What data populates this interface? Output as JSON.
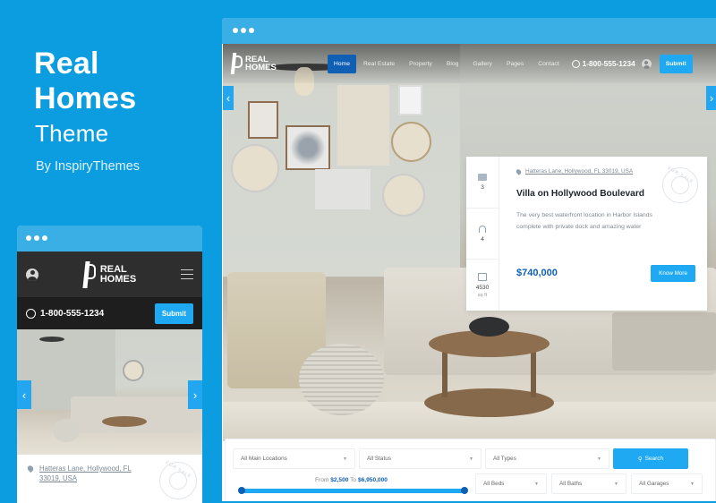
{
  "promo": {
    "title_line1": "Real",
    "title_line2": "Homes",
    "subtitle": "Theme",
    "byline": "By InspiryThemes"
  },
  "brand": {
    "accent": "#1ea9f2",
    "primary": "#0f5fb4",
    "background": "#0c9ce0",
    "logo_line1": "REAL",
    "logo_line2": "HOMES"
  },
  "desktop": {
    "nav": {
      "items": [
        {
          "label": "Home",
          "active": true
        },
        {
          "label": "Real Estate"
        },
        {
          "label": "Property"
        },
        {
          "label": "Blog"
        },
        {
          "label": "Gallery"
        },
        {
          "label": "Pages"
        },
        {
          "label": "Contact"
        }
      ],
      "phone": "1-800-555-1234",
      "submit_label": "Submit"
    },
    "slider": {
      "prev_icon": "‹",
      "next_icon": "›"
    },
    "property_card": {
      "features": [
        {
          "icon": "bed-icon",
          "value": "3"
        },
        {
          "icon": "shower-icon",
          "value": "4"
        },
        {
          "icon": "area-icon",
          "value": "4530",
          "unit": "sq ft"
        }
      ],
      "address": "Hatteras Lane, Hollywood, FL 33019, USA",
      "title": "Villa on Hollywood Boulevard",
      "description": "The very best waterfront location in Harbor Islands complete with private dock and amazing water",
      "price": "$740,000",
      "cta_label": "Know More",
      "stamp_text": "FOR SALE"
    },
    "search": {
      "locations": "All Main Locations",
      "status": "All Status",
      "types": "All Types",
      "search_label": "Search",
      "range_from_label": "From",
      "range_min": "$2,500",
      "range_to_label": "To",
      "range_max": "$6,950,000",
      "beds": "All Beds",
      "baths": "All Baths",
      "garages": "All Garages"
    }
  },
  "mobile": {
    "phone": "1-800-555-1234",
    "submit_label": "Submit",
    "address": "Hatteras Lane, Hollywood, FL 33019, USA",
    "stamp_text": "FOR SALE"
  }
}
